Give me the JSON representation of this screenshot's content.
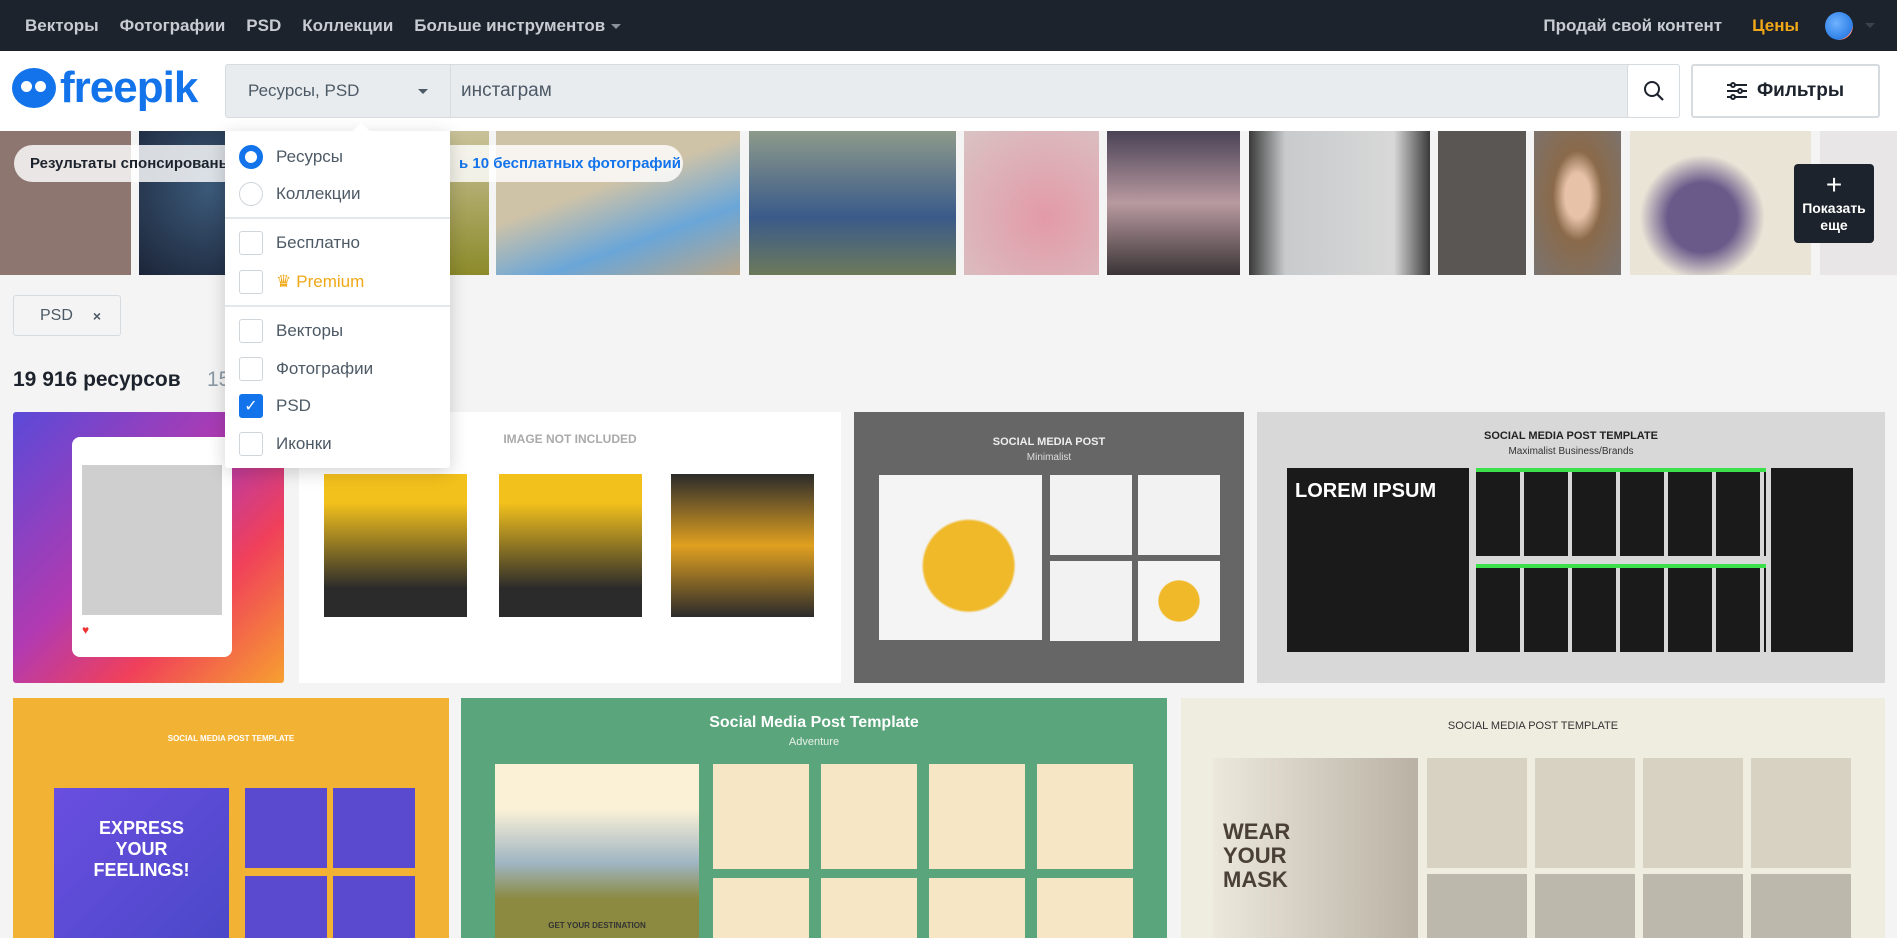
{
  "topnav": {
    "items": [
      "Векторы",
      "Фотографии",
      "PSD",
      "Коллекции",
      "Больше инструментов"
    ],
    "sell": "Продай свой контент",
    "prices": "Цены"
  },
  "logo": "freepik",
  "search": {
    "type_select": "Ресурсы, PSD",
    "query": "инстаграм",
    "filters_label": "Фильтры"
  },
  "sponsored": {
    "text": "Результаты спонсированы",
    "link": "ь 10 бесплатных фотографий",
    "more_label": "Показать еще"
  },
  "dropdown": {
    "radios": [
      {
        "label": "Ресурсы",
        "checked": true
      },
      {
        "label": "Коллекции",
        "checked": false
      }
    ],
    "license": [
      {
        "label": "Бесплатно",
        "checked": false
      },
      {
        "label": "Premium",
        "checked": false
      }
    ],
    "types": [
      {
        "label": "Векторы",
        "checked": false
      },
      {
        "label": "Фотографии",
        "checked": false
      },
      {
        "label": "PSD",
        "checked": true
      },
      {
        "label": "Иконки",
        "checked": false
      }
    ]
  },
  "chip": {
    "label": "PSD",
    "remove": "×"
  },
  "results": {
    "count": "19 916 ресурсов",
    "secondary": "15"
  },
  "cards": [
    {
      "title": "",
      "subtitle": ""
    },
    {
      "title": "IMAGE NOT INCLUDED",
      "subtitle": ""
    },
    {
      "title": "SOCIAL MEDIA POST",
      "subtitle": "Minimalist"
    },
    {
      "title": "SOCIAL MEDIA POST TEMPLATE",
      "subtitle": "Maximalist Business/Brands",
      "headline": "LOREM IPSUM"
    },
    {
      "title": "SOCIAL MEDIA POST TEMPLATE",
      "subtitle": "",
      "headline": "EXPRESS YOUR FEELINGS!"
    },
    {
      "title": "Social Media Post Template",
      "subtitle": "Adventure",
      "headline": "GET YOUR DESTINATION"
    },
    {
      "title": "SOCIAL MEDIA POST TEMPLATE",
      "subtitle": "",
      "headline": "WEAR YOUR MASK"
    }
  ],
  "colors": {
    "accent": "#1273eb",
    "topbar": "#1d232c",
    "premium": "#f0a818"
  }
}
